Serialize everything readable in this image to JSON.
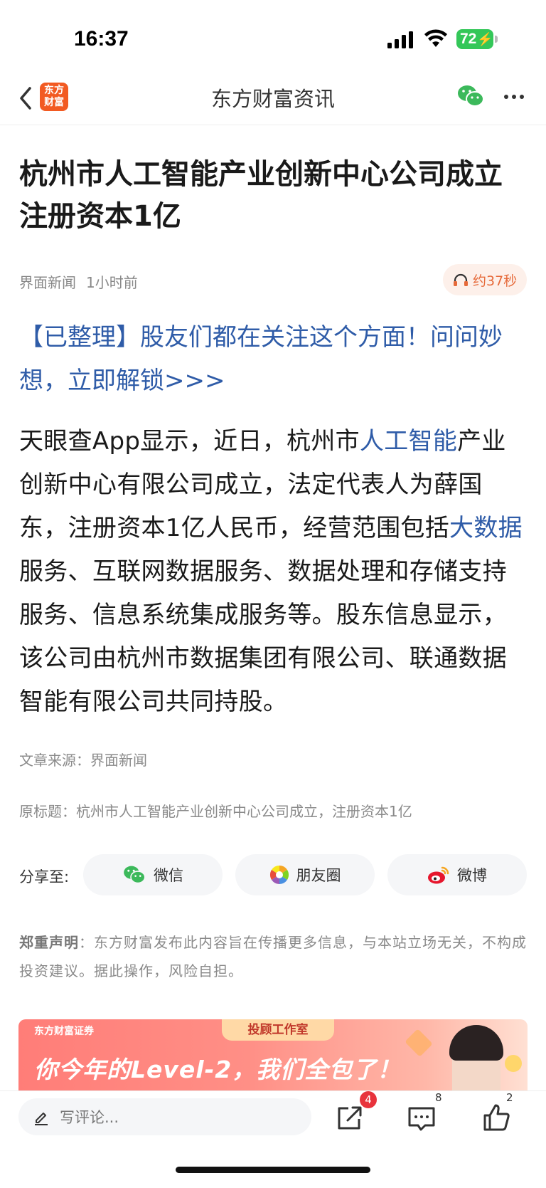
{
  "status_bar": {
    "time": "16:37",
    "battery": "72"
  },
  "nav": {
    "logo_text": "东方财富",
    "title": "东方财富资讯"
  },
  "article": {
    "headline": "杭州市人工智能产业创新中心公司成立 注册资本1亿",
    "source_name": "界面新闻",
    "published": "1小时前",
    "listen_duration": "约37秒",
    "promo_link": "【已整理】股友们都在关注这个方面！问问妙想，立即解锁>>>",
    "body": {
      "p1": "天眼查App显示，近日，杭州市",
      "kw1": "人工智能",
      "p2": "产业创新中心有限公司成立，法定代表人为薛国东，注册资本1亿人民币，经营范围包括",
      "kw2": "大数据",
      "p3": "服务、互联网数据服务、数据处理和存储支持服务、信息系统集成服务等。股东信息显示，该公司由杭州市数据集团有限公司、联通数据智能有限公司共同持股。"
    },
    "source_line": "文章来源：界面新闻",
    "original_title": "原标题：杭州市人工智能产业创新中心公司成立，注册资本1亿"
  },
  "share": {
    "label": "分享至:",
    "wechat": "微信",
    "moments": "朋友圈",
    "weibo": "微博"
  },
  "disclaimer": {
    "label": "郑重声明",
    "text": "：东方财富发布此内容旨在传播更多信息，与本站立场无关，不构成投资建议。据此操作，风险自担。"
  },
  "banner": {
    "brand": "东方财富证券",
    "tab": "投顾工作室",
    "slogan": "你今年的Level-2，我们全包了！"
  },
  "bottom_bar": {
    "comment_placeholder": "写评论...",
    "share_badge": "4",
    "comment_count": "8",
    "like_count": "2"
  },
  "colors": {
    "link_blue": "#2f5ca8",
    "brand_orange": "#f25a22",
    "battery_green": "#34c759",
    "badge_red": "#e8333c"
  }
}
